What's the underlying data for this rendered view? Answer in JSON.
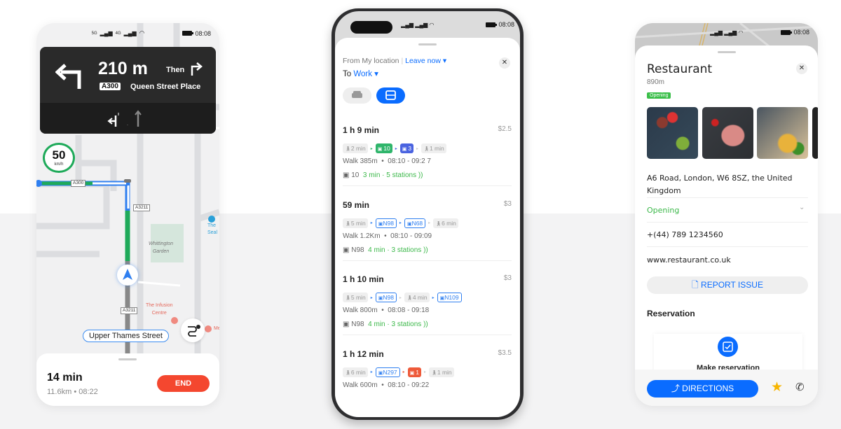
{
  "left_phone": {
    "status": {
      "time": "08:08",
      "signal1": "5G",
      "signal2": "4G"
    },
    "navigation": {
      "distance": "210 m",
      "then_label": "Then",
      "road_badge": "A300",
      "street": "Queen Street Place",
      "turn_icon": "turn-left-arrow",
      "next_turn_icon": "turn-right-arrow"
    },
    "speed_limit": {
      "value": "50",
      "unit": "km/h"
    },
    "map": {
      "road_labels": [
        "A300",
        "A3211",
        "A3211"
      ],
      "places": {
        "garden_line1": "Whittington",
        "garden_line2": "Garden",
        "seal_line1": "The",
        "seal_line2": "Seal",
        "infusion_line1": "The Infusion",
        "infusion_line2": "Centre",
        "me": "Me"
      },
      "current_street": "Upper Thames Street"
    },
    "trip": {
      "duration": "14 min",
      "distance": "11.6km",
      "eta": "08:22",
      "end_label": "END"
    },
    "colors": {
      "route_green": "#1faa5a",
      "route_blue": "#2f7ff0",
      "end_red": "#f4472f"
    }
  },
  "middle_phone": {
    "status": {
      "time": "08:08"
    },
    "header": {
      "from_label": "From My location",
      "leave_label": "Leave now",
      "to_label": "To",
      "to_value": "Work"
    },
    "modes": [
      {
        "icon": "car-icon",
        "active": false
      },
      {
        "icon": "bus-icon",
        "active": true
      }
    ],
    "routes": [
      {
        "duration": "1 h 9 min",
        "price": "$2.5",
        "segments": [
          {
            "type": "walk",
            "label": "2 min"
          },
          {
            "type": "solid",
            "label": "10",
            "color": "#2fb56b"
          },
          {
            "type": "solid",
            "label": "3",
            "color": "#4a63e0"
          },
          {
            "type": "walk",
            "label": "1 min"
          }
        ],
        "walk": "Walk 385m",
        "time": "08:10 - 09:2 7",
        "bus": "10",
        "bus_info": "3 min · 5 stations"
      },
      {
        "duration": "59 min",
        "price": "$3",
        "segments": [
          {
            "type": "walk",
            "label": "5 min"
          },
          {
            "type": "outline",
            "label": "N98",
            "color": "#2f7ff0"
          },
          {
            "type": "outline",
            "label": "N68",
            "color": "#2f7ff0"
          },
          {
            "type": "walk",
            "label": "6 min"
          }
        ],
        "walk": "Walk 1.2Km",
        "time": "08:10 - 09:09",
        "bus": "N98",
        "bus_info": "4 min · 3 stations"
      },
      {
        "duration": "1 h 10 min",
        "price": "$3",
        "segments": [
          {
            "type": "walk",
            "label": "5 min"
          },
          {
            "type": "outline",
            "label": "N98",
            "color": "#2f7ff0"
          },
          {
            "type": "walk",
            "label": "4 min"
          },
          {
            "type": "outline",
            "label": "N109",
            "color": "#2f7ff0"
          }
        ],
        "walk": "Walk 800m",
        "time": "08:08 - 09:18",
        "bus": "N98",
        "bus_info": "4 min · 3 stations"
      },
      {
        "duration": "1 h 12 min",
        "price": "$3.5",
        "segments": [
          {
            "type": "walk",
            "label": "6 min"
          },
          {
            "type": "outline",
            "label": "N297",
            "color": "#2f7ff0"
          },
          {
            "type": "solid",
            "label": "1",
            "color": "#ee5a3a"
          },
          {
            "type": "walk",
            "label": "1 min"
          }
        ],
        "walk": "Walk 600m",
        "time": "08:10 - 09:22"
      }
    ],
    "colors": {
      "accent": "#0a6cff"
    }
  },
  "right_phone": {
    "status": {
      "time": "08:08"
    },
    "place": {
      "name": "Restaurant",
      "distance": "890m",
      "badge": "Opening"
    },
    "address": "A6 Road, London, W6 8SZ, the United Kingdom",
    "hours_status": "Opening",
    "phone": "+(44) 789 1234560",
    "website": "www.restaurant.co.uk",
    "report_label": "REPORT ISSUE",
    "reservation_title": "Reservation",
    "reservation_action": "Make reservation",
    "directions_label": "DIRECTIONS",
    "colors": {
      "accent": "#0a6cff",
      "open_green": "#3cb84a",
      "star": "#f7b500"
    }
  }
}
